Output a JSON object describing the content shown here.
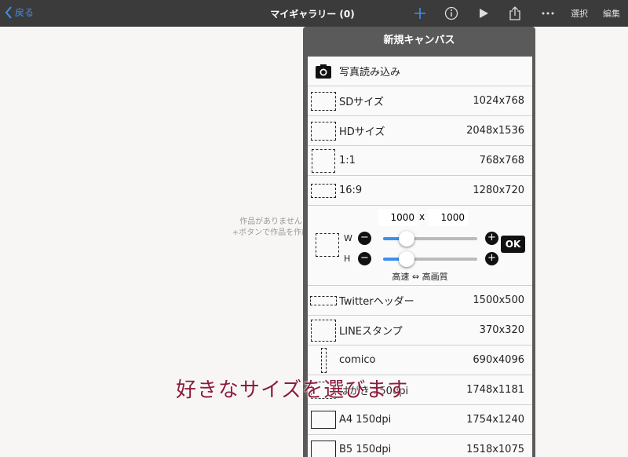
{
  "nav": {
    "back_label": "戻る",
    "title": "マイギャラリー (0)",
    "select_label": "選択",
    "edit_label": "編集",
    "accent": "#3d8ff0"
  },
  "empty_message": {
    "line1": "作品がありません",
    "line2": "+ボタンで作品を作成"
  },
  "popover": {
    "title": "新規キャンバス",
    "import_photo": "写真読み込み",
    "presets": [
      {
        "label": "SDサイズ",
        "size": "1024x768"
      },
      {
        "label": "HDサイズ",
        "size": "2048x1536"
      },
      {
        "label": "1:1",
        "size": "768x768"
      },
      {
        "label": "16:9",
        "size": "1280x720"
      }
    ],
    "custom": {
      "width_value": "1000",
      "height_value": "1000",
      "separator": "x",
      "w_label": "W",
      "h_label": "H",
      "minus": "−",
      "plus": "+",
      "ok_label": "OK",
      "quality_note": "高速 ⇔ 高画質",
      "w_slider_fraction": 0.25,
      "h_slider_fraction": 0.25
    },
    "more_presets": [
      {
        "label": "Twitterヘッダー",
        "size": "1500x500"
      },
      {
        "label": "LINEスタンプ",
        "size": "370x320"
      },
      {
        "label": "comico",
        "size": "690x4096"
      },
      {
        "label": "はがき 350dpi",
        "size": "1748x1181"
      },
      {
        "label": "A4 150dpi",
        "size": "1754x1240"
      },
      {
        "label": "B5 150dpi",
        "size": "1518x1075"
      }
    ]
  },
  "caption": "好きなサイズを選びます"
}
